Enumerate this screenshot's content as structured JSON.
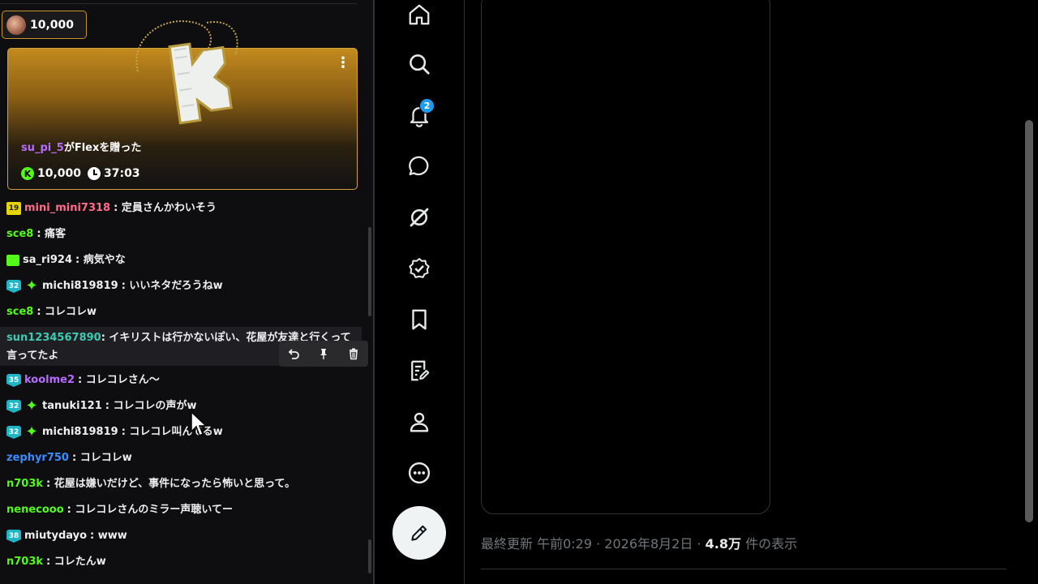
{
  "chat": {
    "top_gift_pill": {
      "amount": "10,000"
    },
    "flex_card": {
      "username": "su_pi_5",
      "gift_text": "がFlexを贈った",
      "coin_icon_letter": "K",
      "amount": "10,000",
      "timer": "37:03",
      "menu_glyph": "⋮"
    },
    "messages": [
      {
        "badges": [
          "sub19"
        ],
        "badge_text": "19",
        "user": "mini_mini7318",
        "color": "#ff6b8b",
        "text": ": 定員さんかわいそう"
      },
      {
        "badges": [],
        "user": "sce8",
        "color": "#53fc18",
        "text": ": 痛客"
      },
      {
        "badges": [
          "gift"
        ],
        "user": "sa_ri924",
        "color": "#efeff1",
        "text": ": 病気やな"
      },
      {
        "badges": [
          "sub",
          "sparkle"
        ],
        "badge_text": "32",
        "user": "michi819819",
        "color": "#efeff1",
        "text": ": いいネタだろうねw"
      },
      {
        "badges": [],
        "user": "sce8",
        "color": "#53fc18",
        "text": ": コレコレw"
      }
    ],
    "highlighted_message": {
      "user": "sun1234567890",
      "color": "#3ec9b0",
      "text": ": イキリストは行かないぽい、花屋が友達と行くって言ってたよ"
    },
    "messages_after": [
      {
        "badges": [
          "sub"
        ],
        "badge_text": "35",
        "user": "koolme2",
        "color": "#b86bff",
        "text": ": コレコレさん～"
      },
      {
        "badges": [
          "sub",
          "sparkle"
        ],
        "badge_text": "32",
        "user": "tanuki121",
        "color": "#efeff1",
        "text": ": コレコレの声がw"
      },
      {
        "badges": [
          "sub",
          "sparkle"
        ],
        "badge_text": "32",
        "user": "michi819819",
        "color": "#efeff1",
        "text": ": コレコレ叫んでるw"
      },
      {
        "badges": [],
        "user": "zephyr750",
        "color": "#3a8dff",
        "text": ": コレコレw"
      },
      {
        "badges": [],
        "user": "n703k",
        "color": "#53fc18",
        "text": ": 花屋は嫌いだけど、事件になったら怖いと思って。"
      },
      {
        "badges": [],
        "user": "nenecooo",
        "color": "#53fc18",
        "text": ": コレコレさんのミラー声聴いてー"
      },
      {
        "badges": [
          "sub"
        ],
        "badge_text": "38",
        "user": "miutydayo",
        "color": "#efeff1",
        "text": ": www"
      },
      {
        "badges": [],
        "user": "n703k",
        "color": "#53fc18",
        "text": ": コレたんw"
      }
    ]
  },
  "x_sidebar": {
    "items": [
      "home-icon",
      "search-icon",
      "notifications-icon",
      "messages-icon",
      "grok-icon",
      "verified-icon",
      "bookmarks-icon",
      "lists-icon",
      "profile-icon",
      "more-icon"
    ],
    "notification_count": "2",
    "compose_icon": "compose-icon"
  },
  "post": {
    "meta_prefix": "最終更新 午前0:29 · 2026年8月2日 · ",
    "views": "4.8万",
    "views_suffix": " 件の表示"
  },
  "colors": {
    "kick_green": "#53fc18",
    "x_blue": "#1d9bf0",
    "flex_gold": "#d4a03a"
  }
}
